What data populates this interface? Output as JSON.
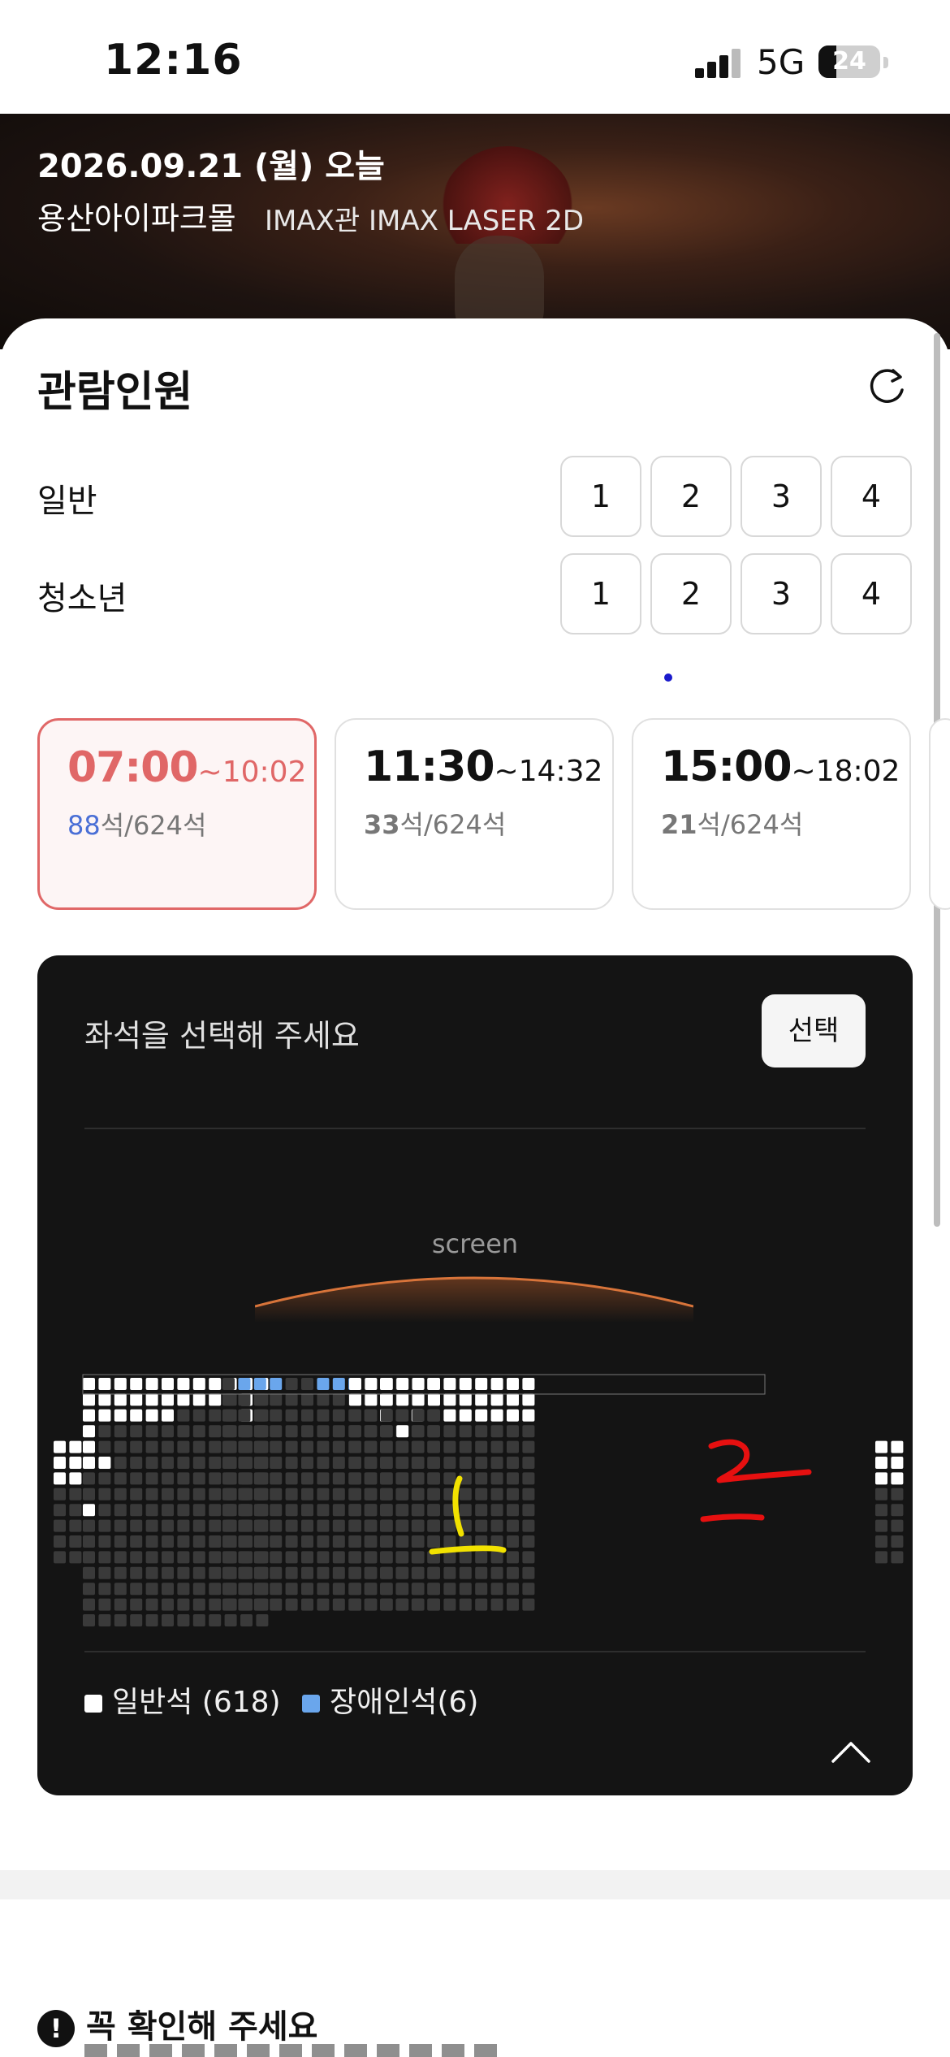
{
  "status_bar": {
    "time": "12:16",
    "network": "5G",
    "battery": "24"
  },
  "header": {
    "date": "2026.09.21 (월) 오늘",
    "theater": "용산아이파크몰",
    "hall": "IMAX관 IMAX LASER 2D"
  },
  "audience": {
    "title": "관람인원",
    "rows": [
      {
        "label": "일반",
        "options": [
          "1",
          "2",
          "3",
          "4"
        ]
      },
      {
        "label": "청소년",
        "options": [
          "1",
          "2",
          "3",
          "4"
        ]
      }
    ]
  },
  "showtimes": [
    {
      "start": "07:00",
      "end": "~10:02",
      "available": "88",
      "total": "석/624석",
      "selected": true
    },
    {
      "start": "11:30",
      "end": "~14:32",
      "available": "33",
      "total": "석/624석",
      "selected": false
    },
    {
      "start": "15:00",
      "end": "~18:02",
      "available": "21",
      "total": "석/624석",
      "selected": false
    }
  ],
  "seatmap": {
    "title": "좌석을 선택해 주세요",
    "select_label": "선택",
    "screen_label": "screen",
    "legend": [
      {
        "label": "일반석 (618)",
        "color": "#ffffff"
      },
      {
        "label": "장애인석(6)",
        "color": "#6aa6ec"
      }
    ],
    "annotations": [
      {
        "text": "1",
        "color": "#f2e200"
      },
      {
        "text": "2",
        "color": "#e61010"
      }
    ]
  },
  "colors": {
    "accent": "#e06767",
    "seat_taken": "#3a3a3a",
    "seat_available": "#ffffff",
    "seat_accessible": "#6aa6ec"
  },
  "notice": {
    "title": "꼭 확인해 주세요"
  }
}
